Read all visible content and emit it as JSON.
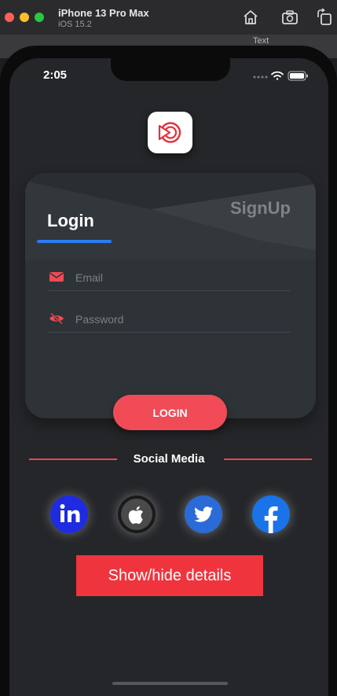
{
  "window": {
    "device_name": "iPhone 13 Pro Max",
    "os_version": "iOS 15.2",
    "background_label": "Text"
  },
  "status_bar": {
    "time": "2:05"
  },
  "auth_card": {
    "login_tab": "Login",
    "signup_tab": "SignUp",
    "email_placeholder": "Email",
    "password_placeholder": "Password",
    "login_button": "LOGIN"
  },
  "social": {
    "title": "Social Media",
    "buttons": [
      {
        "name": "linkedin",
        "icon": "linkedin-icon"
      },
      {
        "name": "apple",
        "icon": "apple-icon"
      },
      {
        "name": "twitter",
        "icon": "twitter-icon"
      },
      {
        "name": "facebook",
        "icon": "facebook-icon"
      }
    ]
  },
  "details_button": "Show/hide details",
  "colors": {
    "accent_red": "#f04b57",
    "tab_underline": "#2d7cf0",
    "screen_bg": "#242629",
    "card_bg": "#2e3337"
  }
}
